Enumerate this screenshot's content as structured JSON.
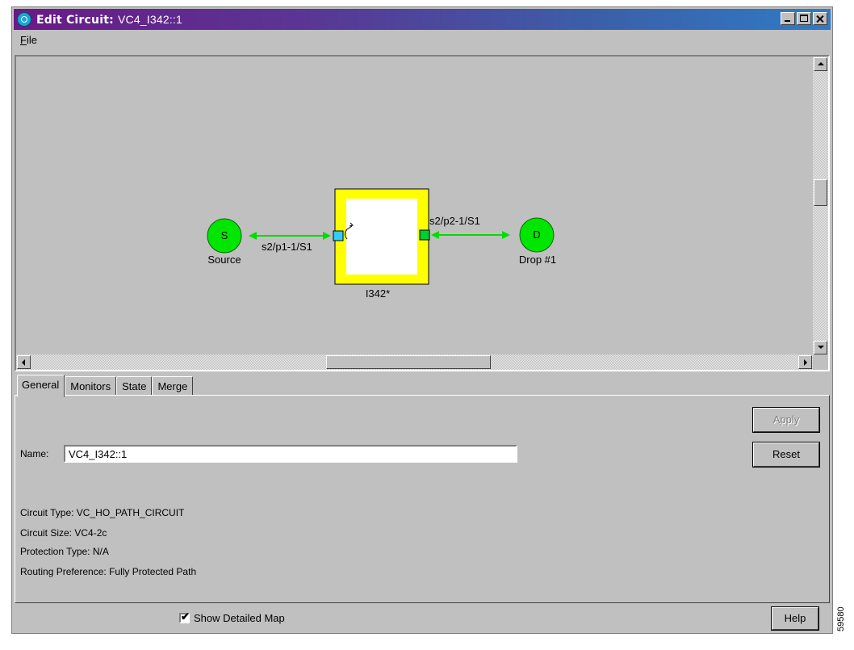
{
  "window": {
    "title_bold": "Edit Circuit:",
    "title_circuit": "VC4_I342::1"
  },
  "menu": {
    "file_first": "F",
    "file_rest": "ile"
  },
  "diagram": {
    "source_letter": "S",
    "source_label": "Source",
    "drop_letter": "D",
    "drop_label": "Drop #1",
    "node_label": "I342*",
    "port_in": "s2/p1-1/S1",
    "port_out": "s2/p2-1/S1",
    "colors": {
      "node_fill": "#00e600",
      "node_border": "#ffff00",
      "link": "#00dd00",
      "port_in": "#33ccff",
      "port_out": "#00cc33"
    }
  },
  "tabs": [
    "General",
    "Monitors",
    "State",
    "Merge"
  ],
  "general": {
    "name_label": "Name:",
    "name_value": "VC4_I342::1",
    "apply_label": "Apply",
    "reset_label": "Reset",
    "circuit_type": "Circuit Type: VC_HO_PATH_CIRCUIT",
    "circuit_size": "Circuit Size: VC4-2c",
    "protection_type": "Protection Type:  N/A",
    "routing_preference": "Routing Preference: Fully Protected Path"
  },
  "footer": {
    "show_map_label": "Show Detailed Map",
    "show_map_checked": true,
    "help_label": "Help"
  },
  "figure_id": "59580"
}
